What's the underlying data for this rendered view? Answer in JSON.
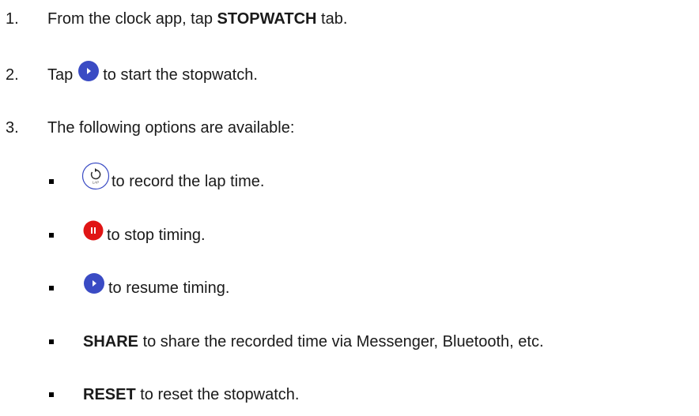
{
  "steps": [
    {
      "num": "1.",
      "pre": "From the clock app, tap ",
      "bold": "STOPWATCH",
      "post": " tab."
    },
    {
      "num": "2.",
      "pre": "Tap",
      "icon": "play-icon",
      "post": "to start the stopwatch."
    },
    {
      "num": "3.",
      "text": "The following options are available:"
    }
  ],
  "options": [
    {
      "icon": "lap-icon",
      "icon_label": "LAP",
      "text": "to record the lap time."
    },
    {
      "icon": "pause-icon",
      "text": "to stop timing."
    },
    {
      "icon": "play-icon",
      "text": "to resume timing."
    },
    {
      "bold": "SHARE",
      "text": " to share the recorded time via Messenger, Bluetooth, etc."
    },
    {
      "bold": "RESET",
      "text": " to reset the stopwatch."
    }
  ],
  "colors": {
    "play": "#3a4bc4",
    "pause": "#e01515",
    "lap_ring": "#3a4bc4"
  }
}
